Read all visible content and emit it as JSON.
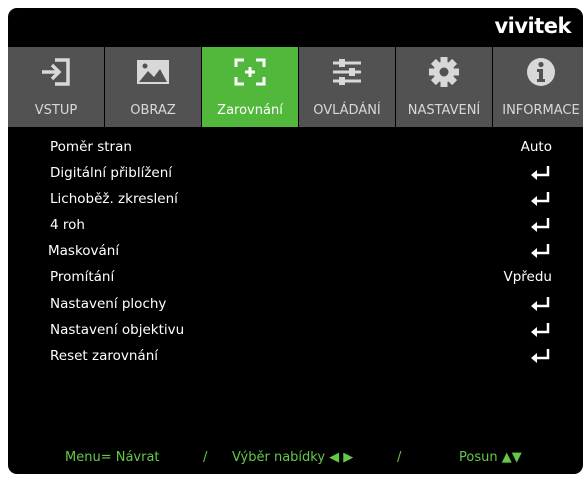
{
  "brand": "vivitek",
  "tabs": [
    {
      "label": "VSTUP",
      "icon": "input-icon",
      "active": false
    },
    {
      "label": "OBRAZ",
      "icon": "image-icon",
      "active": false
    },
    {
      "label": "Zarovnání",
      "icon": "alignment-icon",
      "active": true
    },
    {
      "label": "OVLÁDÁNÍ",
      "icon": "sliders-icon",
      "active": false
    },
    {
      "label": "NASTAVENÍ",
      "icon": "gear-icon",
      "active": false
    },
    {
      "label": "INFORMACE",
      "icon": "info-icon",
      "active": false
    }
  ],
  "menu": [
    {
      "label": "Poměr stran",
      "value": "Auto"
    },
    {
      "label": "Digitální přiblížení",
      "value": null,
      "icon": "enter-icon"
    },
    {
      "label": "Lichoběž. zkreslení",
      "value": null,
      "icon": "enter-icon"
    },
    {
      "label": "4 roh",
      "value": null,
      "icon": "enter-icon"
    },
    {
      "label": "Maskování",
      "value": null,
      "icon": "enter-icon"
    },
    {
      "label": "Promítání",
      "value": "Vpředu"
    },
    {
      "label": "Nastavení plochy",
      "value": null,
      "icon": "enter-icon"
    },
    {
      "label": "Nastavení objektivu",
      "value": null,
      "icon": "enter-icon"
    },
    {
      "label": "Reset zarovnání",
      "value": null,
      "icon": "enter-icon"
    }
  ],
  "footer": {
    "menu_hint": "Menu= Návrat",
    "sep1": "/",
    "select_hint": "Výběr nabídky ◀ ▶",
    "sep2": "/",
    "move_hint": "Posun ▲▼"
  },
  "colors": {
    "accent": "#52b83c",
    "tab_bg": "#525252",
    "footer_text": "#64c84a",
    "background": "#000000"
  }
}
